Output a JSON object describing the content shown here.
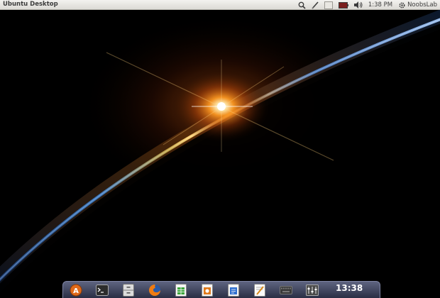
{
  "topbar": {
    "title": "Ubuntu Desktop",
    "indicators": [
      {
        "icon": "search-icon"
      },
      {
        "icon": "pen-icon"
      },
      {
        "icon": "window-icon"
      },
      {
        "icon": "battery-icon"
      },
      {
        "icon": "volume-icon"
      }
    ],
    "clock": "1:38 PM",
    "user_icon": "gear-icon",
    "user_name": "NoobsLab"
  },
  "dock": {
    "items": [
      {
        "icon": "software-center-icon"
      },
      {
        "icon": "terminal-icon"
      },
      {
        "icon": "file-cabinet-icon"
      },
      {
        "icon": "firefox-icon"
      },
      {
        "icon": "spreadsheet-icon"
      },
      {
        "icon": "presentation-icon"
      },
      {
        "icon": "document-icon"
      },
      {
        "icon": "text-editor-icon"
      },
      {
        "icon": "keyboard-icon"
      },
      {
        "icon": "mixer-icon"
      }
    ],
    "clock": "13:38"
  },
  "colors": {
    "panel_bg": "#dcdad5",
    "desktop_bg": "#000000",
    "horizon_blue": "#3a6fb0",
    "sun_orange": "#ff8a1a",
    "dock_bg": "#3a3f58"
  }
}
